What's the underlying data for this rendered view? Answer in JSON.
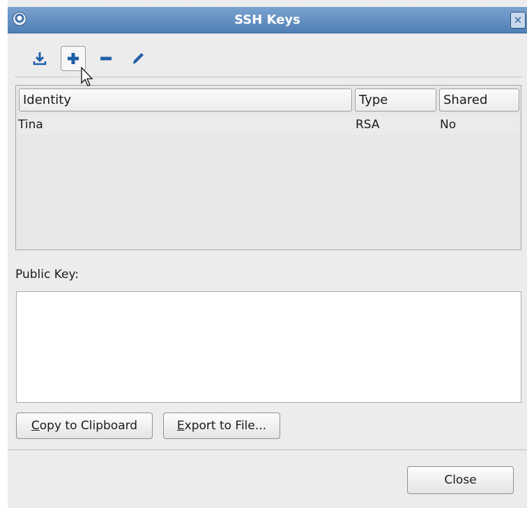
{
  "window": {
    "title": "SSH Keys",
    "close_glyph": "✕"
  },
  "toolbar": {
    "items": [
      {
        "icon": "import-icon",
        "tooltip": ""
      },
      {
        "icon": "add-icon"
      },
      {
        "icon": "remove-icon"
      },
      {
        "icon": "edit-icon"
      }
    ]
  },
  "table": {
    "columns": [
      "Identity",
      "Type",
      "Shared"
    ],
    "rows": [
      {
        "identity": "Tina",
        "type": "RSA",
        "shared": "No"
      }
    ]
  },
  "public_key": {
    "label": "Public Key:",
    "value": ""
  },
  "buttons": {
    "copy": {
      "mnemonic": "C",
      "rest": "opy to Clipboard"
    },
    "export": {
      "mnemonic": "E",
      "rest": "xport to File..."
    },
    "close": "Close"
  },
  "colors": {
    "titlebar": "#5b89bf",
    "accent_blue": "#1f5fa8",
    "window_bg": "#ececec"
  }
}
